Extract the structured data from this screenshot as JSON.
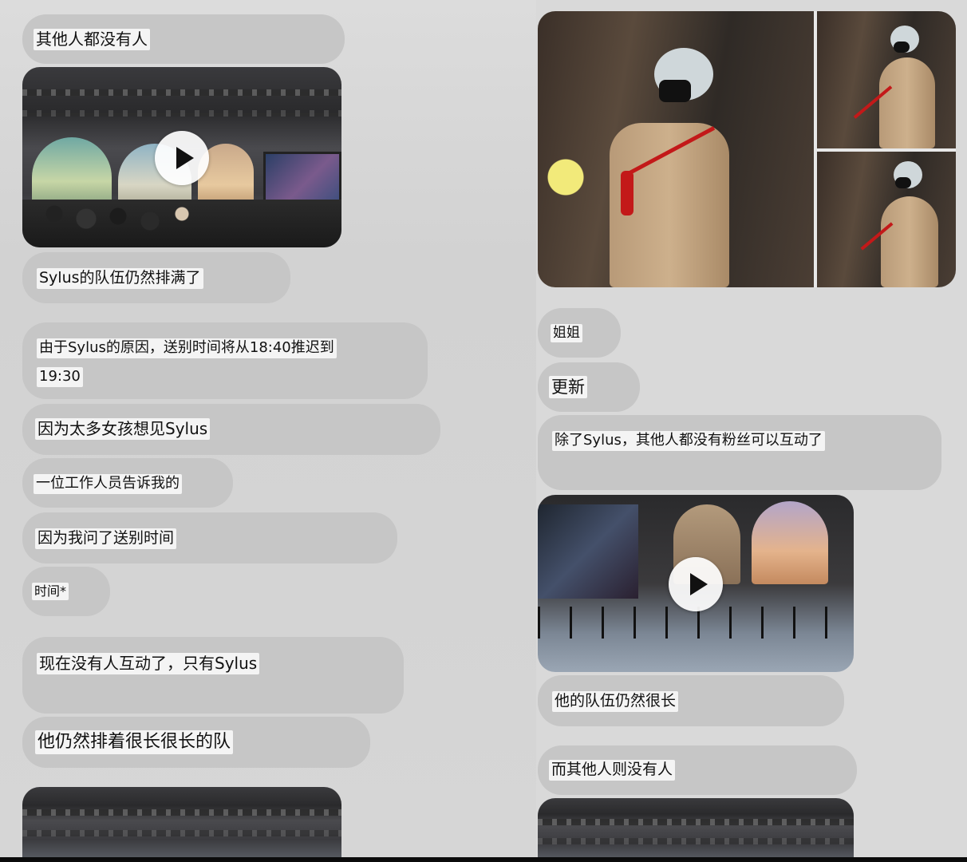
{
  "left": {
    "messages": [
      "其他人都没有人",
      "Sylus的队伍仍然排满了",
      "由于Sylus的原因，送别时间将从18:40推迟到",
      "19:30",
      "因为太多女孩想见Sylus",
      "一位工作人员告诉我的",
      "因为我问了送别时间",
      "时间*",
      "现在没有人互动了，只有Sylus",
      "他仍然排着很长很长的队"
    ]
  },
  "right": {
    "messages": [
      "姐姐",
      "更新",
      "除了Sylus，其他人都没有粉丝可以互动了",
      "他的队伍仍然很长",
      "而其他人则没有人"
    ]
  },
  "icons": {
    "play": "play-icon"
  }
}
